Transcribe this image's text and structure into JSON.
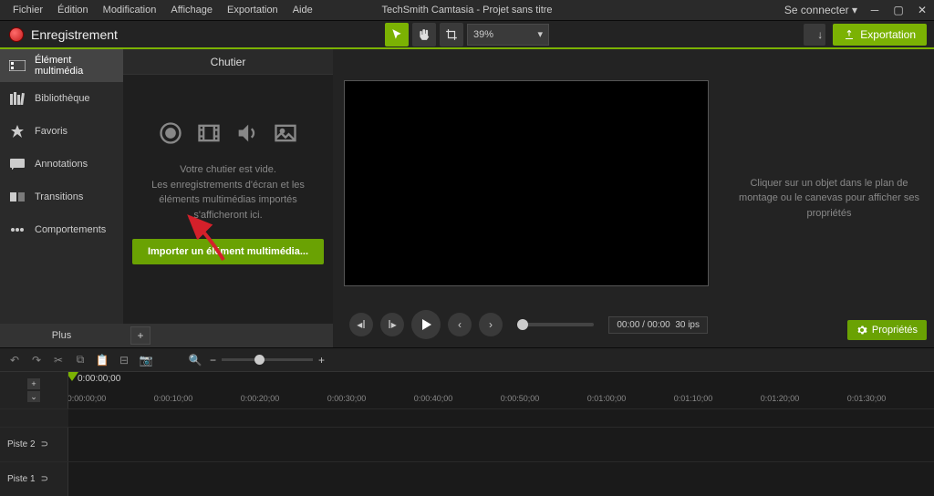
{
  "menubar": {
    "items": [
      "Fichier",
      "Édition",
      "Modification",
      "Affichage",
      "Exportation",
      "Aide"
    ],
    "title": "TechSmith Camtasia - Projet sans titre",
    "signin": "Se connecter"
  },
  "toolbar": {
    "record": "Enregistrement",
    "zoom": "39%",
    "export": "Exportation"
  },
  "sidebar": {
    "items": [
      {
        "label": "Élément multimédia"
      },
      {
        "label": "Bibliothèque"
      },
      {
        "label": "Favoris"
      },
      {
        "label": "Annotations"
      },
      {
        "label": "Transitions"
      },
      {
        "label": "Comportements"
      }
    ],
    "more": "Plus"
  },
  "bin": {
    "title": "Chutier",
    "empty1": "Votre chutier est vide.",
    "empty2": "Les enregistrements d'écran et les éléments multimédias importés s'afficheront ici.",
    "import": "Importer un élément multimédia..."
  },
  "props": {
    "hint": "Cliquer sur un objet dans le plan de montage ou le canevas pour afficher ses propriétés",
    "button": "Propriétés"
  },
  "playback": {
    "time": "00:00 / 00:00",
    "fps": "30 ips"
  },
  "timeline": {
    "playhead": "0:00:00;00",
    "ticks": [
      "0:00:00;00",
      "0:00:10;00",
      "0:00:20;00",
      "0:00:30;00",
      "0:00:40;00",
      "0:00:50;00",
      "0:01:00;00",
      "0:01:10;00",
      "0:01:20;00",
      "0:01:30;00"
    ],
    "tracks": [
      "Piste 2",
      "Piste 1"
    ]
  }
}
